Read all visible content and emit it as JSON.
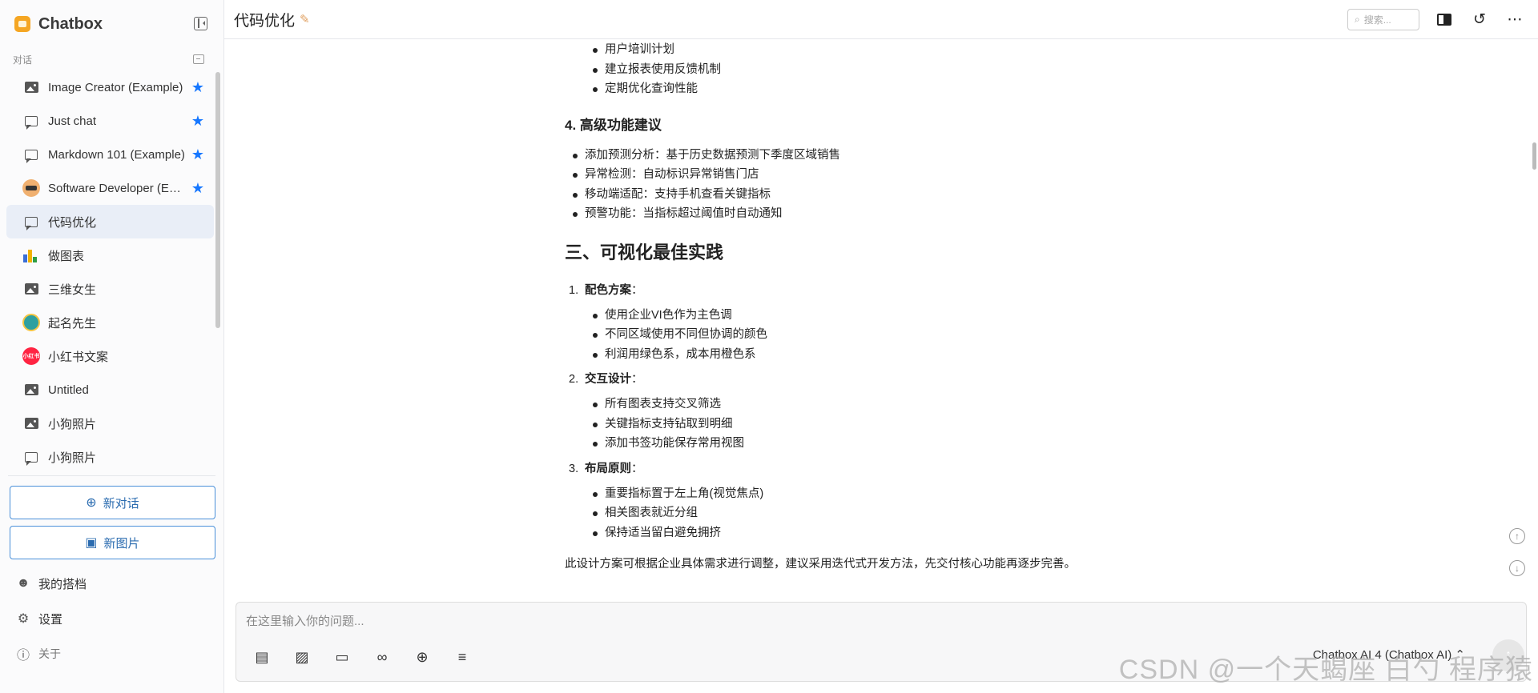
{
  "app": {
    "name": "Chatbox"
  },
  "sidebar": {
    "section_label": "对话",
    "conversations": [
      {
        "label": "Image Creator (Example)",
        "icon": "image-icon",
        "starred": true
      },
      {
        "label": "Just chat",
        "icon": "chat-icon",
        "starred": true
      },
      {
        "label": "Markdown 101 (Example)",
        "icon": "chat-icon",
        "starred": true
      },
      {
        "label": "Software Developer (Example)",
        "icon": "avatar-icon",
        "starred": true
      },
      {
        "label": "代码优化",
        "icon": "chat-icon",
        "starred": false,
        "active": true
      },
      {
        "label": "做图表",
        "icon": "chart-icon",
        "starred": false
      },
      {
        "label": "三维女生",
        "icon": "image-icon",
        "starred": false
      },
      {
        "label": "起名先生",
        "icon": "avatar-icon",
        "starred": false
      },
      {
        "label": "小红书文案",
        "icon": "xiaohongshu-icon",
        "starred": false
      },
      {
        "label": "Untitled",
        "icon": "image-icon",
        "starred": false
      },
      {
        "label": "小狗照片",
        "icon": "image-icon",
        "starred": false
      },
      {
        "label": "小狗照片",
        "icon": "chat-icon",
        "starred": false
      }
    ],
    "new_chat_label": "新对话",
    "new_image_label": "新图片",
    "my_copilots_label": "我的搭档",
    "settings_label": "设置",
    "about_label": "关于",
    "xhs_badge": "小红书"
  },
  "header": {
    "title": "代码优化",
    "search_placeholder": "搜索..."
  },
  "message": {
    "top_list": [
      "用户培训计划",
      "建立报表使用反馈机制",
      "定期优化查询性能"
    ],
    "h3_advanced": "4. 高级功能建议",
    "advanced_list": [
      "添加预测分析：基于历史数据预测下季度区域销售",
      "异常检测：自动标识异常销售门店",
      "移动端适配：支持手机查看关键指标",
      "预警功能：当指标超过阈值时自动通知"
    ],
    "h2_best": "三、可视化最佳实践",
    "ol": [
      {
        "num": "1.",
        "title": "配色方案",
        "items": [
          "使用企业VI色作为主色调",
          "不同区域使用不同但协调的颜色",
          "利润用绿色系，成本用橙色系"
        ]
      },
      {
        "num": "2.",
        "title": "交互设计",
        "items": [
          "所有图表支持交叉筛选",
          "关键指标支持钻取到明细",
          "添加书签功能保存常用视图"
        ]
      },
      {
        "num": "3.",
        "title": "布局原则",
        "items": [
          "重要指标置于左上角(视觉焦点)",
          "相关图表就近分组",
          "保持适当留白避免拥挤"
        ]
      }
    ],
    "colon": "：",
    "closing": "此设计方案可根据企业具体需求进行调整，建议采用迭代式开发方法，先交付核心功能再逐步完善。"
  },
  "composer": {
    "placeholder": "在这里输入你的问题...",
    "model": "Chatbox AI 4 (Chatbox AI)",
    "model_chevron": "⌃"
  },
  "watermark": "CSDN @一个天蝎座 白勺 程序猿",
  "colors": {
    "accent": "#1677ff",
    "active_bg": "#e9eef7",
    "button_border": "#4a90d9"
  }
}
